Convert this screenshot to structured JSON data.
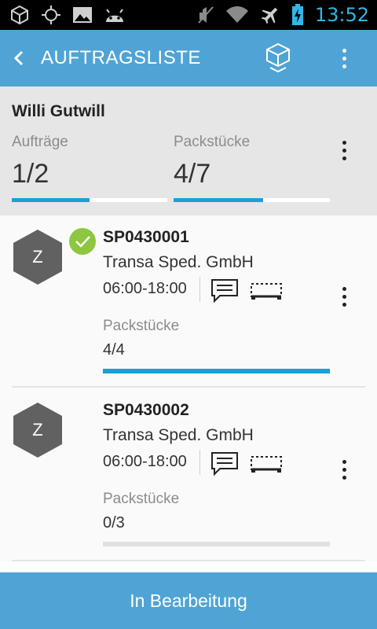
{
  "statusbar": {
    "time": "13:52",
    "icons": [
      "cube-notification-icon",
      "gps-icon",
      "image-icon",
      "android-icon",
      "mute-icon",
      "wifi-icon",
      "airplane-icon",
      "battery-charging-icon"
    ]
  },
  "appbar": {
    "title": "AUFTRAGSLISTE",
    "icons": [
      "back-arrow-icon",
      "cube-icon",
      "overflow-menu-icon"
    ]
  },
  "summary": {
    "name": "Willi Gutwill",
    "orders_label": "Aufträge",
    "orders_value": "1/2",
    "orders_progress": 0.5,
    "packages_label": "Packstücke",
    "packages_value": "4/7",
    "packages_progress": 0.571
  },
  "orders": [
    {
      "avatar_letter": "Z",
      "completed": true,
      "order_no": "SP0430001",
      "company": "Transa Sped. GmbH",
      "time": "06:00-18:00",
      "packages_label": "Packstücke",
      "packages_value": "4/4",
      "progress": 1.0
    },
    {
      "avatar_letter": "Z",
      "completed": false,
      "order_no": "SP0430002",
      "company": "Transa Sped. GmbH",
      "time": "06:00-18:00",
      "packages_label": "Packstücke",
      "packages_value": "0/3",
      "progress": 0.0
    }
  ],
  "bottom_button": "In Bearbeitung",
  "colors": {
    "accent": "#4fa4d5",
    "progress": "#1e9fd4",
    "avatar": "#616161",
    "check": "#8dc63f",
    "status_time": "#33b5e5"
  }
}
